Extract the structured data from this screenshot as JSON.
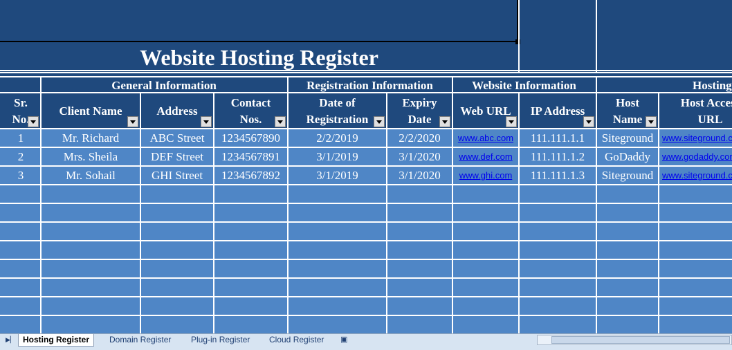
{
  "title": "Website Hosting Register",
  "sections": {
    "general": "General Information",
    "registration": "Registration Information",
    "website": "Website Information",
    "hosting": "Hosting"
  },
  "columns": {
    "sr": [
      "Sr.",
      "No."
    ],
    "client": [
      "Client Name"
    ],
    "address": [
      "Address"
    ],
    "contact": [
      "Contact",
      "Nos."
    ],
    "reg_date": [
      "Date of",
      "Registration"
    ],
    "expiry": [
      "Expiry",
      "Date"
    ],
    "web_url": [
      "Web URL"
    ],
    "ip": [
      "IP Address"
    ],
    "host_name": [
      "Host",
      "Name"
    ],
    "host_url": [
      "Host Access",
      "URL"
    ]
  },
  "rows": [
    {
      "sr": "1",
      "client": "Mr. Richard",
      "address": "ABC Street",
      "contact": "1234567890",
      "reg_date": "2/2/2019",
      "expiry": "2/2/2020",
      "web_url": "www.abc.com",
      "ip": "111.111.1.1",
      "host_name": "Siteground",
      "host_url": "www.siteground.com"
    },
    {
      "sr": "2",
      "client": "Mrs. Sheila",
      "address": "DEF Street",
      "contact": "1234567891",
      "reg_date": "3/1/2019",
      "expiry": "3/1/2020",
      "web_url": "www.def.com",
      "ip": "111.111.1.2",
      "host_name": "GoDaddy",
      "host_url": "www.godaddy.com"
    },
    {
      "sr": "3",
      "client": "Mr. Sohail",
      "address": "GHI Street",
      "contact": "1234567892",
      "reg_date": "3/1/2019",
      "expiry": "3/1/2020",
      "web_url": "www.ghi.com",
      "ip": "111.111.1.3",
      "host_name": "Siteground",
      "host_url": "www.siteground.com"
    }
  ],
  "sheet_tabs": [
    "Hosting Register",
    "Domain Register",
    "Plug-in Register",
    "Cloud Register"
  ],
  "active_tab": "Hosting Register",
  "colors": {
    "dark_blue": "#1f497d",
    "row_blue": "#4f86c6",
    "grid": "#ffffff",
    "link": "#0000ee"
  }
}
